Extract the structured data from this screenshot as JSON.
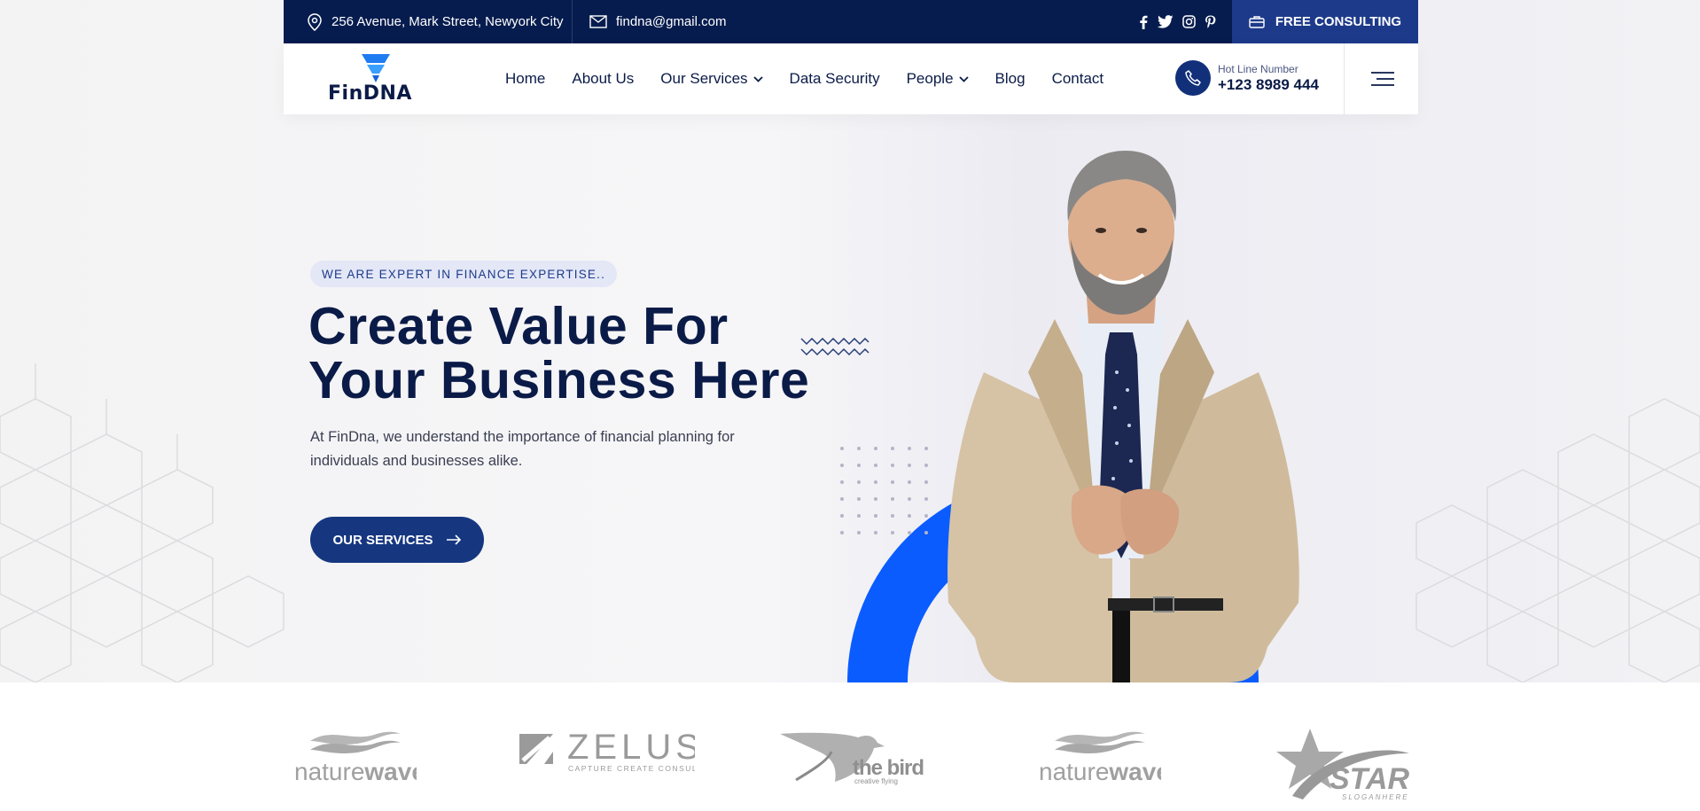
{
  "topbar": {
    "address": "256 Avenue, Mark Street, Newyork City",
    "email": "findna@gmail.com",
    "social": [
      "f",
      "t",
      "ig",
      "p"
    ],
    "consult_label": "FREE CONSULTING"
  },
  "nav": {
    "logo_text": "FinDNA",
    "items": [
      {
        "label": "Home",
        "dropdown": false
      },
      {
        "label": "About Us",
        "dropdown": false
      },
      {
        "label": "Our Services",
        "dropdown": true
      },
      {
        "label": "Data Security",
        "dropdown": false
      },
      {
        "label": "People",
        "dropdown": true
      },
      {
        "label": "Blog",
        "dropdown": false
      },
      {
        "label": "Contact",
        "dropdown": false
      }
    ],
    "hotline_label": "Hot Line Number",
    "hotline_number": "+123 8989 444"
  },
  "hero": {
    "tagline": "WE ARE EXPERT IN FINANCE EXPERTISE..",
    "headline_line1": "Create Value For",
    "headline_line2": "Your Business Here",
    "description": "At FinDna, we understand the importance of financial planning for individuals and businesses alike.",
    "cta_label": "OUR SERVICES"
  },
  "brands": [
    {
      "name_a": "nature",
      "name_b": "wave"
    },
    {
      "name": "ZELUS",
      "sub": "CAPTURE CREATE CONSULT"
    },
    {
      "name": "the bird",
      "sub": "creative flying"
    },
    {
      "name_a": "nature",
      "name_b": "wave"
    },
    {
      "name": "STAR",
      "sub": "SLOGANHERE"
    }
  ],
  "colors": {
    "navy": "#061c4e",
    "accent_blue": "#0a5cff",
    "button": "#163780"
  }
}
